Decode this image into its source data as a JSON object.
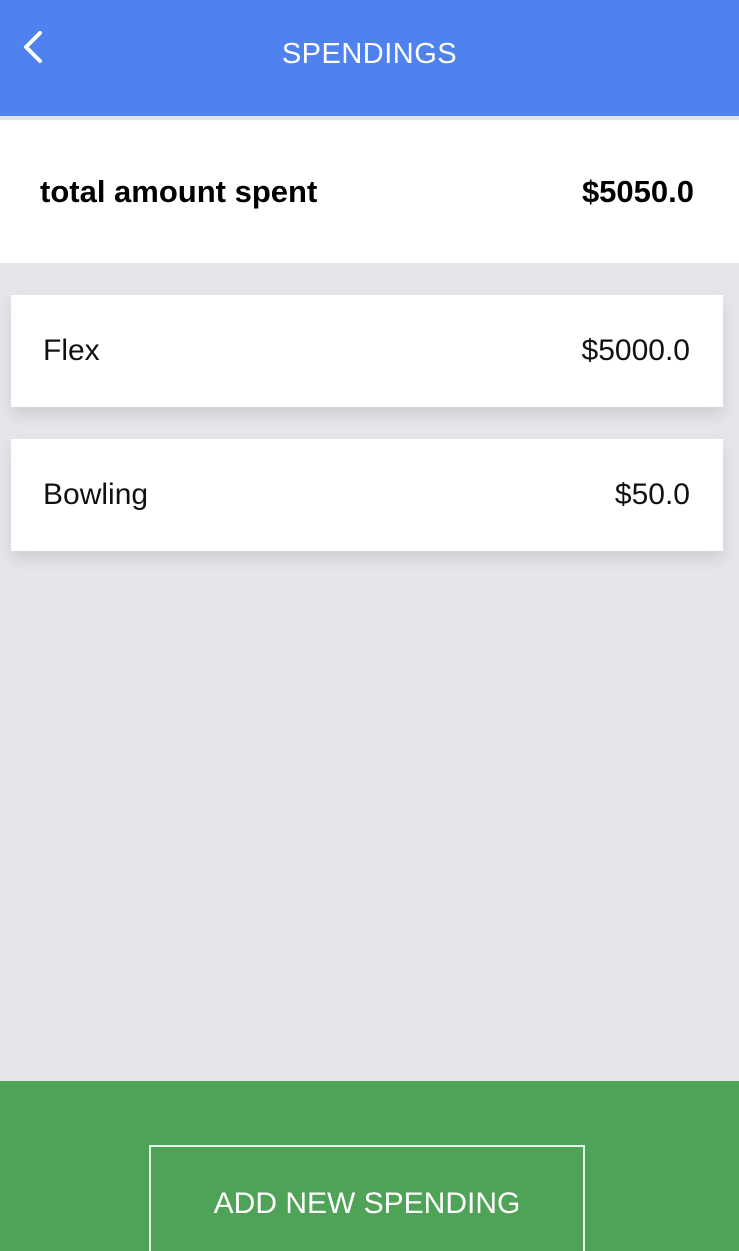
{
  "header": {
    "title": "SPENDINGS",
    "back_icon": "chevron-left-icon",
    "color": "#4f82ee"
  },
  "summary": {
    "label": "total amount spent",
    "total": "$5050.0"
  },
  "spendings": [
    {
      "name": "Flex",
      "amount": "$5000.0"
    },
    {
      "name": "Bowling",
      "amount": "$50.0"
    }
  ],
  "footer": {
    "add_button_label": "ADD NEW SPENDING",
    "color": "#4ea356"
  }
}
